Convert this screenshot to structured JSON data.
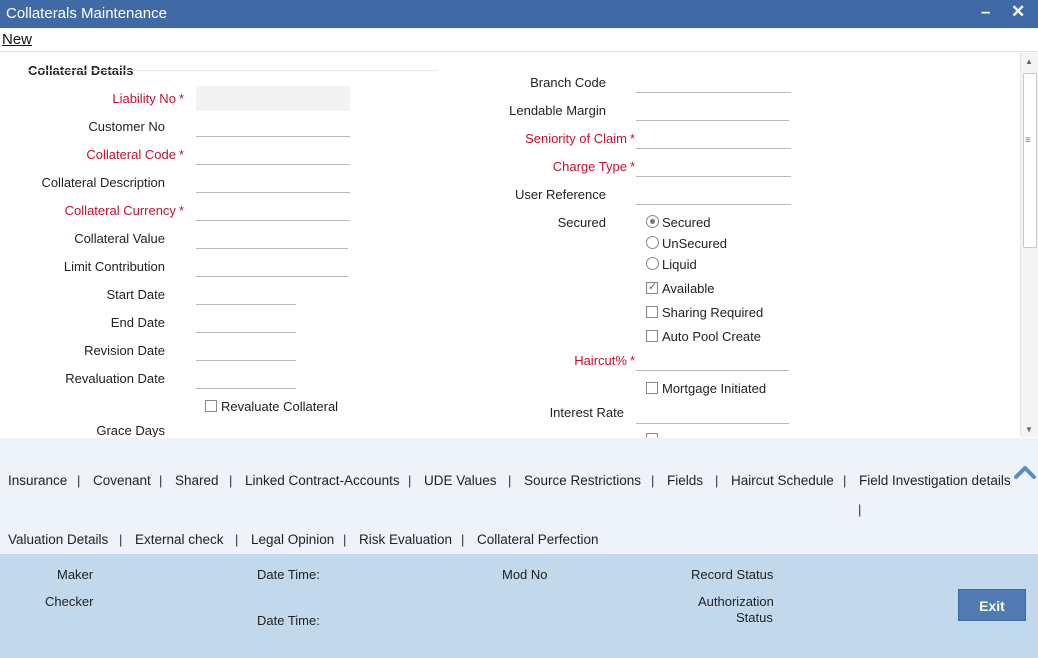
{
  "window": {
    "title": "Collaterals Maintenance",
    "minimize_glyph": "–",
    "close_glyph": "✕"
  },
  "menu": {
    "new_label": "New"
  },
  "form": {
    "section_title": "Collateral Details",
    "left_fields": [
      {
        "label": "Liability No",
        "required": true,
        "value": "",
        "readonly": true
      },
      {
        "label": "Customer No",
        "required": false,
        "value": ""
      },
      {
        "label": "Collateral Code",
        "required": true,
        "value": ""
      },
      {
        "label": "Collateral Description",
        "required": false,
        "value": ""
      },
      {
        "label": "Collateral Currency",
        "required": true,
        "value": ""
      },
      {
        "label": "Collateral Value",
        "required": false,
        "value": ""
      },
      {
        "label": "Limit Contribution",
        "required": false,
        "value": ""
      },
      {
        "label": "Start Date",
        "required": false,
        "value": ""
      },
      {
        "label": "End Date",
        "required": false,
        "value": ""
      },
      {
        "label": "Revision Date",
        "required": false,
        "value": ""
      },
      {
        "label": "Revaluation Date",
        "required": false,
        "value": ""
      }
    ],
    "revaluate_collateral": {
      "label": "Revaluate Collateral",
      "checked": false
    },
    "grace_days_label": "Grace Days",
    "right_fields": [
      {
        "label": "Branch Code",
        "required": false,
        "value": ""
      },
      {
        "label": "Lendable Margin",
        "required": false,
        "value": ""
      },
      {
        "label": "Seniority of Claim",
        "required": true,
        "value": ""
      },
      {
        "label": "Charge Type",
        "required": true,
        "value": ""
      },
      {
        "label": "User Reference",
        "required": false,
        "value": ""
      }
    ],
    "secured": {
      "label": "Secured",
      "options": [
        {
          "label": "Secured",
          "selected": true
        },
        {
          "label": "UnSecured",
          "selected": false
        },
        {
          "label": "Liquid",
          "selected": false
        }
      ]
    },
    "checkboxes": [
      {
        "label": "Available",
        "checked": true
      },
      {
        "label": "Sharing Required",
        "checked": false
      },
      {
        "label": "Auto Pool Create",
        "checked": false
      }
    ],
    "haircut": {
      "label": "Haircut%",
      "required": true,
      "value": ""
    },
    "mortgage_initiated": {
      "label": "Mortgage Initiated",
      "checked": false
    },
    "interest_rate": {
      "label": "Interest Rate",
      "value": ""
    },
    "required_marker": "*"
  },
  "tabs_row1": [
    "Insurance",
    "Covenant",
    "Shared",
    "Linked Contract-Accounts",
    "UDE Values",
    "Source Restrictions",
    "Fields",
    "Haircut Schedule",
    "Field Investigation details"
  ],
  "tabs_row2": [
    "Valuation Details",
    "External check",
    "Legal Opinion",
    "Risk Evaluation",
    "Collateral Perfection"
  ],
  "tab_separator": "|",
  "footer": {
    "maker_label": "Maker",
    "checker_label": "Checker",
    "date_time_label": "Date Time:",
    "mod_no_label": "Mod No",
    "record_status_label": "Record Status",
    "authorization_label": "Authorization",
    "status_label": "Status",
    "exit_label": "Exit"
  },
  "colors": {
    "titlebar": "#3f6aa6",
    "required_label": "#c8102e",
    "tabs_background": "#edf3f9",
    "footer_background": "#c2d9ec",
    "exit_button": "#4f7bb2"
  },
  "icons": {
    "minimize": "minimize-icon",
    "close": "close-icon",
    "collapse": "chevron-up-icon",
    "scroll_up": "scroll-up-arrow-icon",
    "scroll_down": "scroll-down-arrow-icon"
  }
}
